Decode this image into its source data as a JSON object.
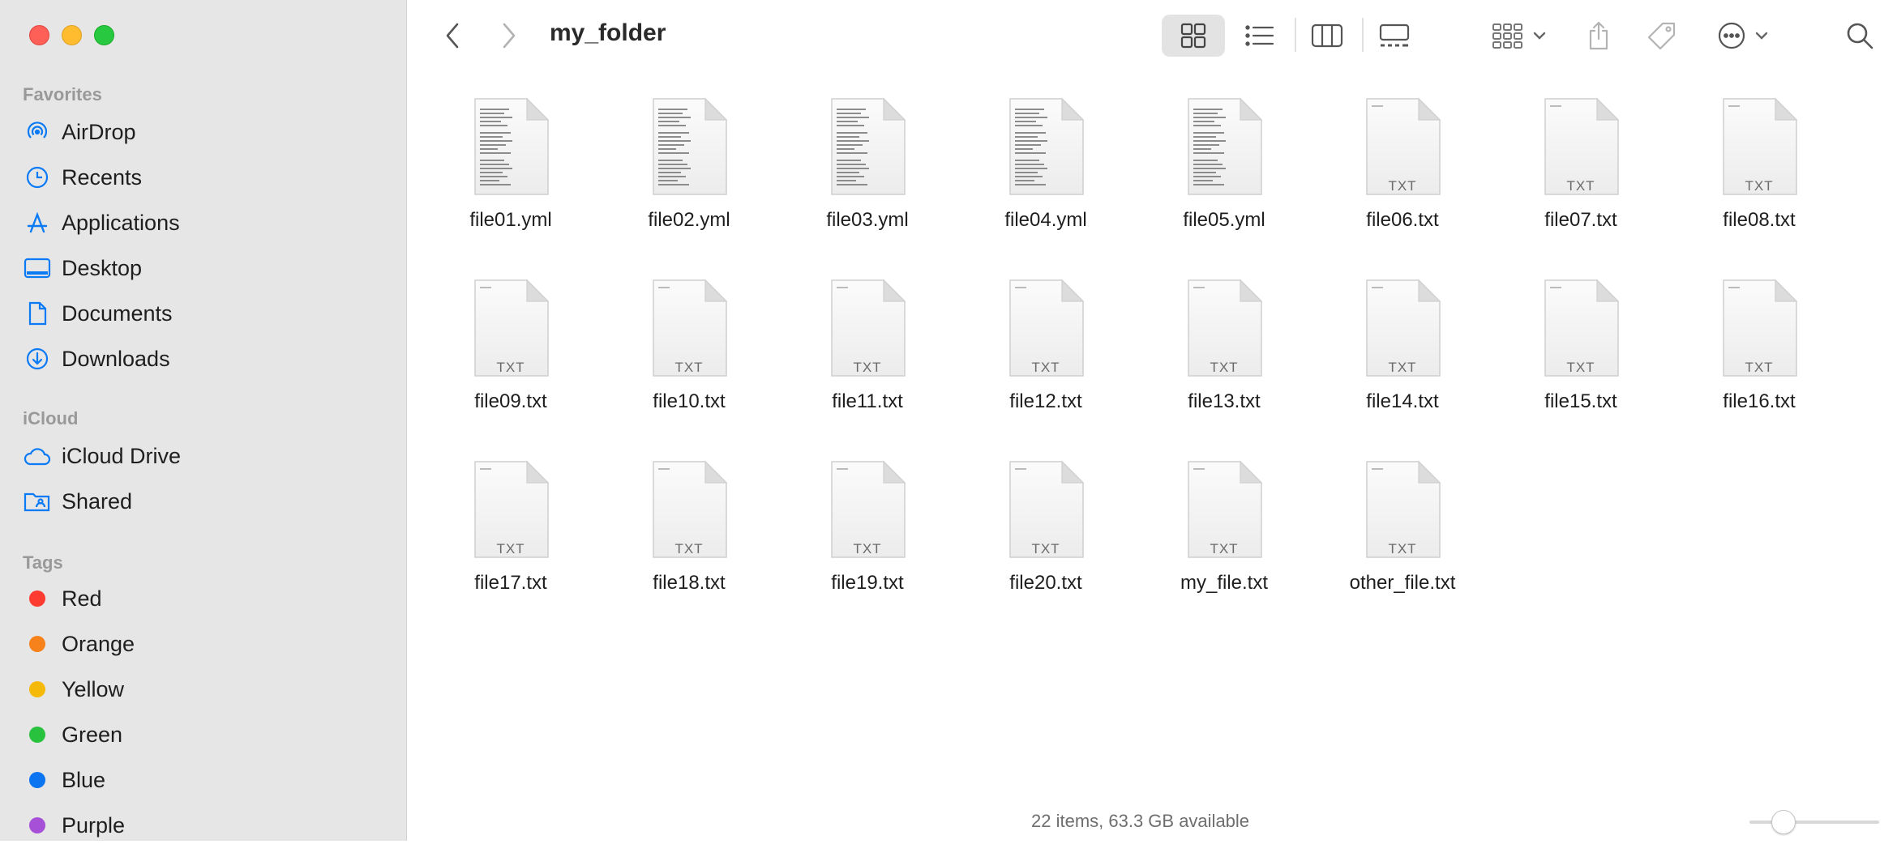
{
  "window": {
    "title": "my_folder"
  },
  "sidebar": {
    "favorites_title": "Favorites",
    "favorites": [
      {
        "label": "AirDrop",
        "icon": "airdrop-icon"
      },
      {
        "label": "Recents",
        "icon": "clock-icon"
      },
      {
        "label": "Applications",
        "icon": "applications-icon"
      },
      {
        "label": "Desktop",
        "icon": "desktop-icon"
      },
      {
        "label": "Documents",
        "icon": "document-icon"
      },
      {
        "label": "Downloads",
        "icon": "download-icon"
      }
    ],
    "icloud_title": "iCloud",
    "icloud": [
      {
        "label": "iCloud Drive",
        "icon": "cloud-icon"
      },
      {
        "label": "Shared",
        "icon": "shared-folder-icon"
      }
    ],
    "tags_title": "Tags",
    "tags": [
      {
        "label": "Red",
        "color": "#fe3b30"
      },
      {
        "label": "Orange",
        "color": "#f7821b"
      },
      {
        "label": "Yellow",
        "color": "#f5b90a"
      },
      {
        "label": "Green",
        "color": "#28c23f"
      },
      {
        "label": "Blue",
        "color": "#0b74f0"
      },
      {
        "label": "Purple",
        "color": "#a550d6"
      }
    ]
  },
  "toolbar": {
    "accent": "#0a7af5"
  },
  "files": [
    {
      "name": "file01.yml",
      "kind": "yml"
    },
    {
      "name": "file02.yml",
      "kind": "yml"
    },
    {
      "name": "file03.yml",
      "kind": "yml"
    },
    {
      "name": "file04.yml",
      "kind": "yml"
    },
    {
      "name": "file05.yml",
      "kind": "yml"
    },
    {
      "name": "file06.txt",
      "kind": "TXT"
    },
    {
      "name": "file07.txt",
      "kind": "TXT"
    },
    {
      "name": "file08.txt",
      "kind": "TXT"
    },
    {
      "name": "file09.txt",
      "kind": "TXT"
    },
    {
      "name": "file10.txt",
      "kind": "TXT"
    },
    {
      "name": "file11.txt",
      "kind": "TXT"
    },
    {
      "name": "file12.txt",
      "kind": "TXT"
    },
    {
      "name": "file13.txt",
      "kind": "TXT"
    },
    {
      "name": "file14.txt",
      "kind": "TXT"
    },
    {
      "name": "file15.txt",
      "kind": "TXT"
    },
    {
      "name": "file16.txt",
      "kind": "TXT"
    },
    {
      "name": "file17.txt",
      "kind": "TXT"
    },
    {
      "name": "file18.txt",
      "kind": "TXT"
    },
    {
      "name": "file19.txt",
      "kind": "TXT"
    },
    {
      "name": "file20.txt",
      "kind": "TXT"
    },
    {
      "name": "my_file.txt",
      "kind": "TXT"
    },
    {
      "name": "other_file.txt",
      "kind": "TXT"
    }
  ],
  "status": {
    "text": "22 items, 63.3 GB available"
  }
}
